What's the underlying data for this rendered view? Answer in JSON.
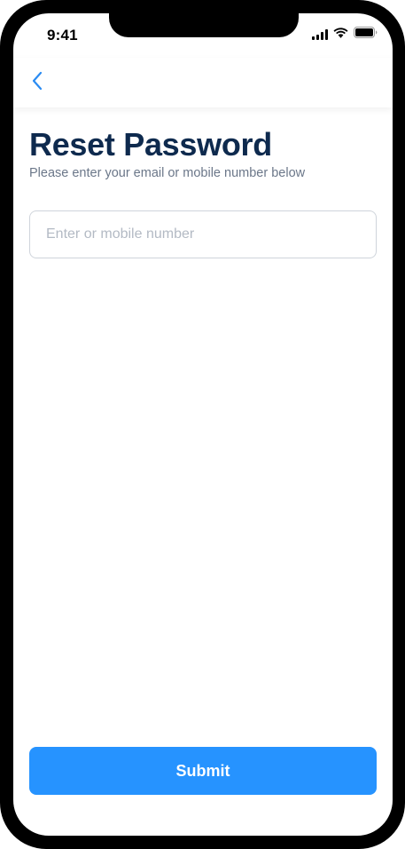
{
  "status_bar": {
    "time": "9:41",
    "icons": [
      "signal-icon",
      "wifi-icon",
      "battery-icon"
    ]
  },
  "nav": {
    "back_icon": "chevron-left-icon"
  },
  "page": {
    "title": "Reset Password",
    "subtitle": "Please enter your email or mobile number below"
  },
  "form": {
    "input_placeholder": "Enter or mobile number",
    "input_value": ""
  },
  "actions": {
    "submit_label": "Submit"
  },
  "colors": {
    "primary": "#2693ff",
    "title": "#0e2a4e",
    "subtitle": "#6b7789",
    "input_border": "#cfd4db",
    "back_icon": "#2a8bf2"
  }
}
